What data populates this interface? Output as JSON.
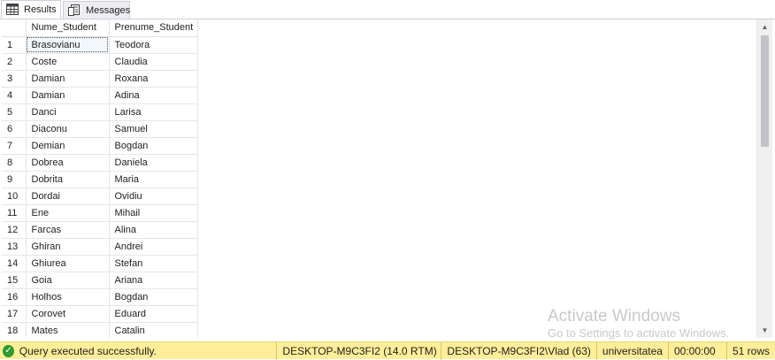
{
  "tabs": {
    "results_label": "Results",
    "messages_label": "Messages"
  },
  "grid": {
    "columns": [
      "",
      "Nume_Student",
      "Prenume_Student"
    ],
    "rows": [
      [
        "1",
        "Brasovianu",
        "Teodora"
      ],
      [
        "2",
        "Coste",
        "Claudia"
      ],
      [
        "3",
        "Damian",
        "Roxana"
      ],
      [
        "4",
        "Damian",
        "Adina"
      ],
      [
        "5",
        "Danci",
        "Larisa"
      ],
      [
        "6",
        "Diaconu",
        "Samuel"
      ],
      [
        "7",
        "Demian",
        "Bogdan"
      ],
      [
        "8",
        "Dobrea",
        "Daniela"
      ],
      [
        "9",
        "Dobrita",
        "Maria"
      ],
      [
        "10",
        "Dordai",
        "Ovidiu"
      ],
      [
        "11",
        "Ene",
        "Mihail"
      ],
      [
        "12",
        "Farcas",
        "Alina"
      ],
      [
        "13",
        "Ghiran",
        "Andrei"
      ],
      [
        "14",
        "Ghiurea",
        "Stefan"
      ],
      [
        "15",
        "Goia",
        "Ariana"
      ],
      [
        "16",
        "Holhos",
        "Bogdan"
      ],
      [
        "17",
        "Corovet",
        "Eduard"
      ],
      [
        "18",
        "Mates",
        "Catalin"
      ]
    ]
  },
  "watermark": {
    "title": "Activate Windows",
    "subtitle": "Go to Settings to activate Windows."
  },
  "status": {
    "message": "Query executed successfully.",
    "server": "DESKTOP-M9C3FI2 (14.0 RTM)",
    "user": "DESKTOP-M9C3FI2\\Vlad (63)",
    "database": "universitatea",
    "elapsed": "00:00:00",
    "rows": "51 rows"
  },
  "colors": {
    "status_bg": "#ffee99",
    "success_icon": "#2e9c2e"
  },
  "icons": [
    "grid-icon",
    "messages-icon",
    "scroll-up-icon",
    "scroll-down-icon",
    "success-check-icon"
  ]
}
